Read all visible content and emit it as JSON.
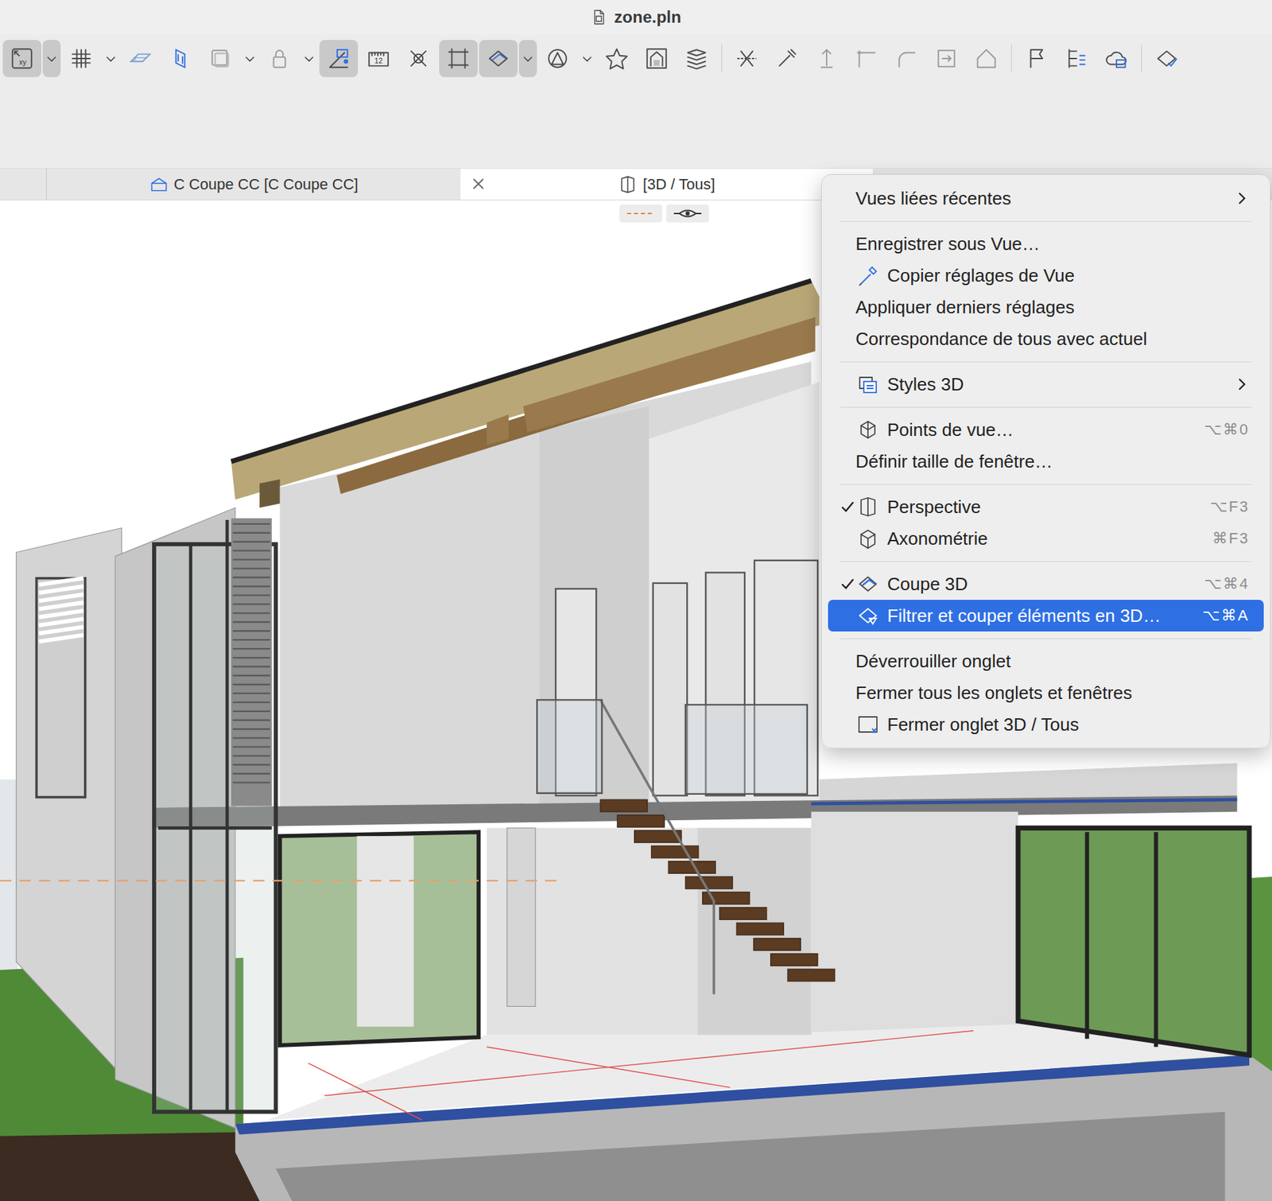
{
  "window": {
    "title": "zone.pln"
  },
  "toolbar": {
    "buttons": [
      {
        "kind": "coords",
        "label": "xy",
        "pressed": true
      },
      {
        "kind": "chevron",
        "pressed": true
      },
      {
        "kind": "grid",
        "pressed": false
      },
      {
        "kind": "chevron",
        "pressed": false
      },
      {
        "kind": "plane",
        "pressed": false
      },
      {
        "kind": "gravity",
        "pressed": false
      },
      {
        "kind": "layer",
        "pressed": false
      },
      {
        "kind": "chevron",
        "pressed": false
      },
      {
        "kind": "lock",
        "pressed": false
      },
      {
        "kind": "chevron",
        "pressed": false
      },
      {
        "kind": "ortho",
        "pressed": true
      },
      {
        "kind": "ruler",
        "label": "12",
        "pressed": false
      },
      {
        "kind": "snap",
        "pressed": false
      },
      {
        "kind": "frame",
        "pressed": true
      },
      {
        "kind": "section",
        "pressed": true
      },
      {
        "kind": "chevron",
        "pressed": true
      },
      {
        "kind": "marquee",
        "pressed": false
      },
      {
        "kind": "chevron",
        "pressed": false
      },
      {
        "kind": "star",
        "pressed": false
      },
      {
        "kind": "elev",
        "pressed": false
      },
      {
        "kind": "stack",
        "pressed": false
      },
      {
        "kind": "separator"
      },
      {
        "kind": "trim",
        "pressed": false
      },
      {
        "kind": "magic",
        "pressed": false
      },
      {
        "kind": "elevate",
        "pressed": false
      },
      {
        "kind": "corner",
        "pressed": false
      },
      {
        "kind": "fillet",
        "pressed": false
      },
      {
        "kind": "offset",
        "pressed": false
      },
      {
        "kind": "roof",
        "pressed": false
      },
      {
        "kind": "separator"
      },
      {
        "kind": "flag",
        "pressed": false
      },
      {
        "kind": "list",
        "pressed": false
      },
      {
        "kind": "cloud",
        "pressed": false
      },
      {
        "kind": "separator"
      },
      {
        "kind": "check",
        "pressed": false
      }
    ]
  },
  "tabs": [
    {
      "label": "C Coupe CC [C Coupe CC]",
      "selected": false,
      "kind": "section"
    },
    {
      "label": "[3D / Tous]",
      "selected": true,
      "kind": "3d"
    }
  ],
  "menu": {
    "sections": [
      {
        "items": [
          {
            "label": "Vues liées récentes",
            "kind": "plain",
            "submenu": true,
            "checked": false,
            "highlighted": false,
            "shortcut": ""
          }
        ]
      },
      {
        "items": [
          {
            "label": "Enregistrer sous Vue…",
            "kind": "plain",
            "submenu": false,
            "checked": false,
            "highlighted": false,
            "shortcut": ""
          },
          {
            "label": "Copier réglages de Vue",
            "kind": "eyedropper",
            "submenu": false,
            "checked": false,
            "highlighted": false,
            "shortcut": ""
          },
          {
            "label": "Appliquer derniers réglages",
            "kind": "plain",
            "submenu": false,
            "checked": false,
            "highlighted": false,
            "shortcut": ""
          },
          {
            "label": "Correspondance de tous avec actuel",
            "kind": "plain",
            "submenu": false,
            "checked": false,
            "highlighted": false,
            "shortcut": ""
          }
        ]
      },
      {
        "items": [
          {
            "label": "Styles 3D",
            "kind": "styles",
            "submenu": true,
            "checked": false,
            "highlighted": false,
            "shortcut": ""
          }
        ]
      },
      {
        "items": [
          {
            "label": "Points de vue…",
            "kind": "viewpoints",
            "submenu": false,
            "checked": false,
            "highlighted": false,
            "shortcut": "⌥⌘0"
          },
          {
            "label": "Définir taille de fenêtre…",
            "kind": "plain",
            "submenu": false,
            "checked": false,
            "highlighted": false,
            "shortcut": ""
          }
        ]
      },
      {
        "items": [
          {
            "label": "Perspective",
            "kind": "perspective",
            "submenu": false,
            "checked": true,
            "highlighted": false,
            "shortcut": "⌥F3"
          },
          {
            "label": "Axonométrie",
            "kind": "axonometry",
            "submenu": false,
            "checked": false,
            "highlighted": false,
            "shortcut": "⌘F3"
          }
        ]
      },
      {
        "items": [
          {
            "label": "Coupe 3D",
            "kind": "section3d",
            "submenu": false,
            "checked": true,
            "highlighted": false,
            "shortcut": "⌥⌘4"
          },
          {
            "label": "Filtrer et couper éléments en 3D…",
            "kind": "filter",
            "submenu": false,
            "checked": false,
            "highlighted": true,
            "shortcut": "⌥⌘A"
          }
        ]
      },
      {
        "items": [
          {
            "label": "Déverrouiller onglet",
            "kind": "plain",
            "submenu": false,
            "checked": false,
            "highlighted": false,
            "shortcut": ""
          },
          {
            "label": "Fermer tous les onglets et fenêtres",
            "kind": "plain",
            "submenu": false,
            "checked": false,
            "highlighted": false,
            "shortcut": ""
          },
          {
            "label": "Fermer onglet 3D / Tous",
            "kind": "close",
            "submenu": false,
            "checked": false,
            "highlighted": false,
            "shortcut": ""
          }
        ]
      }
    ]
  }
}
